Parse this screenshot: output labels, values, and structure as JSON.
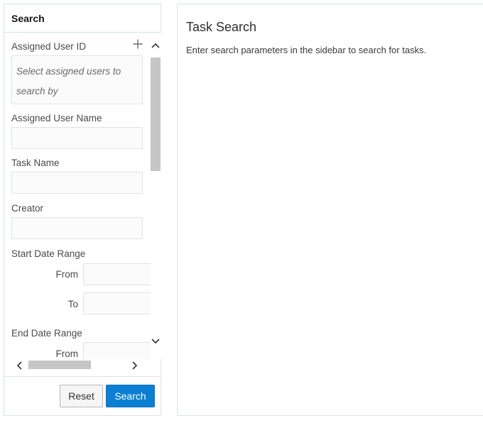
{
  "sidebar": {
    "title": "Search",
    "fields": {
      "assigned_user_id": {
        "label": "Assigned User ID",
        "placeholder_line1": "Select assigned users to",
        "placeholder_line2": "search by"
      },
      "assigned_user_name": {
        "label": "Assigned User Name",
        "value": ""
      },
      "task_name": {
        "label": "Task Name",
        "value": ""
      },
      "creator": {
        "label": "Creator",
        "value": ""
      },
      "start_date_range": {
        "label": "Start Date Range",
        "from_label": "From",
        "to_label": "To"
      },
      "end_date_range": {
        "label": "End Date Range",
        "from_label": "From"
      }
    },
    "icons": {
      "add": "plus-icon",
      "scroll_up": "chevron-up-icon",
      "scroll_down": "chevron-down-icon",
      "scroll_left": "chevron-left-icon",
      "scroll_right": "chevron-right-icon"
    },
    "footer": {
      "reset_label": "Reset",
      "search_label": "Search"
    }
  },
  "main": {
    "title": "Task Search",
    "description": "Enter search parameters in the sidebar to search for tasks."
  },
  "colors": {
    "primary_button": "#0b7fd3",
    "border": "#dde3e6"
  }
}
